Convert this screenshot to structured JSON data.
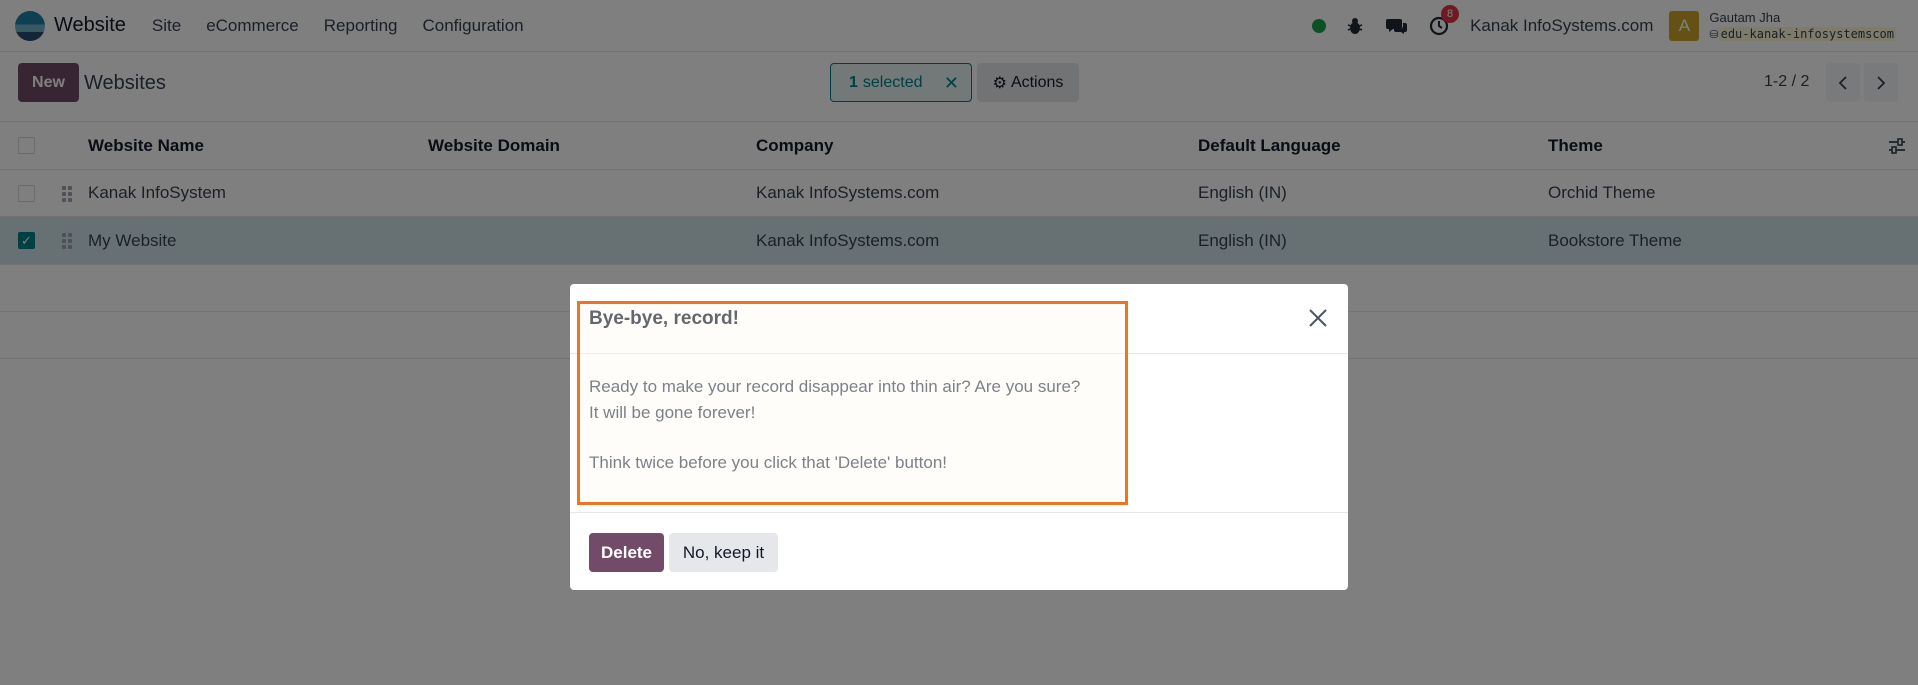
{
  "navbar": {
    "app_name": "Website",
    "menu": [
      "Site",
      "eCommerce",
      "Reporting",
      "Configuration"
    ],
    "activity_count": "8",
    "company": "Kanak InfoSystems.com",
    "avatar_letter": "A",
    "user_name": "Gautam Jha",
    "database": "edu-kanak-infosystemscom"
  },
  "control": {
    "new_label": "New",
    "title": "Websites",
    "selected_count": "1",
    "selected_text": "selected",
    "actions_label": "Actions",
    "pager": "1-2 / 2"
  },
  "table": {
    "headers": [
      "Website Name",
      "Website Domain",
      "Company",
      "Default Language",
      "Theme"
    ],
    "rows": [
      {
        "name": "Kanak InfoSystem",
        "domain": "",
        "company": "Kanak InfoSystems.com",
        "language": "English (IN)",
        "theme": "Orchid Theme",
        "checked": false
      },
      {
        "name": "My Website",
        "domain": "",
        "company": "Kanak InfoSystems.com",
        "language": "English (IN)",
        "theme": "Bookstore Theme",
        "checked": true
      }
    ]
  },
  "dialog": {
    "title": "Bye-bye, record!",
    "body_line1": "Ready to make your record disappear into thin air? Are you sure?",
    "body_line2": "It will be gone forever!",
    "body_line3": "Think twice before you click that 'Delete' button!",
    "delete_label": "Delete",
    "keep_label": "No, keep it"
  },
  "colors": {
    "brand": "#714b67",
    "accent": "#017e84",
    "highlight": "#f07322",
    "status_online": "#16a34a"
  }
}
